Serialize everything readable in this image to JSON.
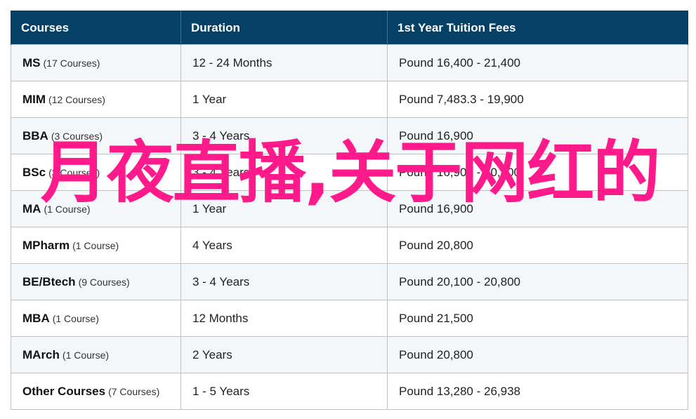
{
  "table": {
    "headers": [
      "Courses",
      "Duration",
      "1st Year Tuition Fees"
    ],
    "rows": [
      {
        "course": "MS",
        "count": "(17 Courses)",
        "duration": "12 - 24 Months",
        "fees": "Pound 16,400 - 21,400"
      },
      {
        "course": "MIM",
        "count": "(12 Courses)",
        "duration": "1 Year",
        "fees": "Pound 7,483.3 - 19,900"
      },
      {
        "course": "BBA",
        "count": "(3 Courses)",
        "duration": "3 - 4 Years",
        "fees": "Pound 16,900"
      },
      {
        "course": "BSc",
        "count": "(3 Courses)",
        "duration": "3 - 4 Years",
        "fees": "Pound 16,900 - 20,800"
      },
      {
        "course": "MA",
        "count": "(1 Course)",
        "duration": "1 Year",
        "fees": "Pound 16,900"
      },
      {
        "course": "MPharm",
        "count": "(1 Course)",
        "duration": "4 Years",
        "fees": "Pound 20,800"
      },
      {
        "course": "BE/Btech",
        "count": "(9 Courses)",
        "duration": "3 - 4 Years",
        "fees": "Pound 20,100 - 20,800"
      },
      {
        "course": "MBA",
        "count": "(1 Course)",
        "duration": "12 Months",
        "fees": "Pound 21,500"
      },
      {
        "course": "MArch",
        "count": "(1 Course)",
        "duration": "2 Years",
        "fees": "Pound 20,800"
      },
      {
        "course": "Other Courses",
        "count": "(7 Courses)",
        "duration": "1 - 5 Years",
        "fees": "Pound 13,280 - 26,938"
      }
    ]
  },
  "overlay": {
    "text": "月夜直播,关于网红的"
  },
  "colors": {
    "header_bg": "#054166",
    "overlay_text": "#ff1a8c"
  }
}
